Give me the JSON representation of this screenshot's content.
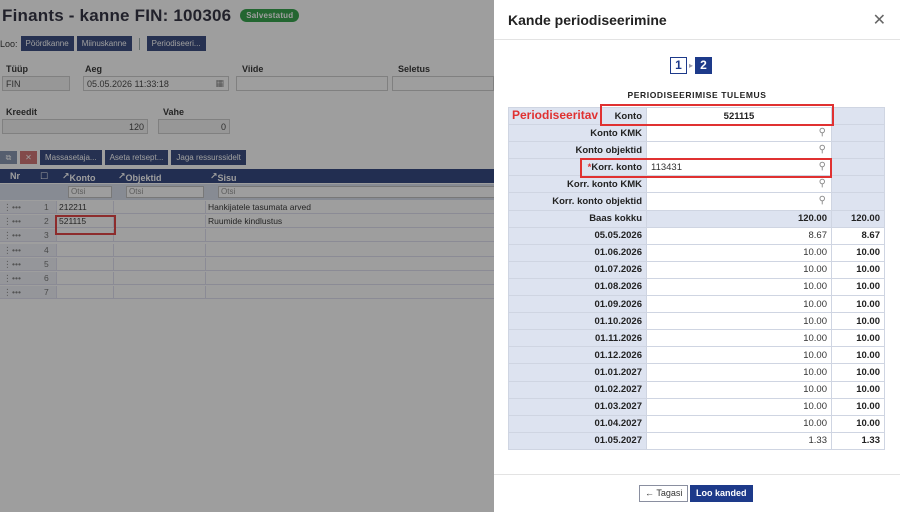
{
  "page": {
    "title": "Finants - kanne FIN: 100306",
    "status_badge": "Salvestatud",
    "loo_label": "Loo:",
    "loo_buttons": [
      "Pöördkanne",
      "Miinuskanne"
    ],
    "periodiseeri_button": "Periodiseeri...",
    "fields": {
      "tyyp_label": "Tüüp",
      "tyyp_value": "FIN",
      "aeg_label": "Aeg",
      "aeg_value": "05.05.2026 11:33:18",
      "viide_label": "Viide",
      "seletus_label": "Seletus",
      "kreedit_label": "Kreedit",
      "kreedit_value": "120",
      "vahe_label": "Vahe",
      "vahe_value": "0"
    },
    "toolbar": [
      "Massasetaja...",
      "Aseta retsept...",
      "Jaga ressurssidelt"
    ],
    "grid": {
      "columns": [
        "Nr",
        "Konto",
        "Objektid",
        "Sisu"
      ],
      "filter_placeholder": "Otsi",
      "rows": [
        {
          "nr": "1",
          "konto": "212211",
          "sisu": "Hankijatele tasumata arved"
        },
        {
          "nr": "2",
          "konto": "521115",
          "sisu": "Ruumide kindlustus"
        },
        {
          "nr": "3",
          "konto": "",
          "sisu": ""
        },
        {
          "nr": "4",
          "konto": "",
          "sisu": ""
        },
        {
          "nr": "5",
          "konto": "",
          "sisu": ""
        },
        {
          "nr": "6",
          "konto": "",
          "sisu": ""
        },
        {
          "nr": "7",
          "konto": "",
          "sisu": ""
        }
      ]
    }
  },
  "modal": {
    "title": "Kande periodiseerimine",
    "steps": [
      "1",
      "2"
    ],
    "active_step": 2,
    "result_title": "PERIODISEERIMISE TULEMUS",
    "periodiseeritav_label": "Periodiseeritav",
    "konto_label": "Konto",
    "konto_value": "521115",
    "konto_kmk_label": "Konto KMK",
    "konto_objektid_label": "Konto objektid",
    "korr_konto_required": "*",
    "korr_konto_label": "Korr. konto",
    "korr_konto_value": "113431",
    "korr_konto_kmk_label": "Korr. konto KMK",
    "korr_konto_objektid_label": "Korr. konto objektid",
    "baas_label": "Baas kokku",
    "baas_value": "120.00",
    "baas_total": "120.00",
    "periods": [
      {
        "date": "05.05.2026",
        "value": "8.67",
        "total": "8.67"
      },
      {
        "date": "01.06.2026",
        "value": "10.00",
        "total": "10.00"
      },
      {
        "date": "01.07.2026",
        "value": "10.00",
        "total": "10.00"
      },
      {
        "date": "01.08.2026",
        "value": "10.00",
        "total": "10.00"
      },
      {
        "date": "01.09.2026",
        "value": "10.00",
        "total": "10.00"
      },
      {
        "date": "01.10.2026",
        "value": "10.00",
        "total": "10.00"
      },
      {
        "date": "01.11.2026",
        "value": "10.00",
        "total": "10.00"
      },
      {
        "date": "01.12.2026",
        "value": "10.00",
        "total": "10.00"
      },
      {
        "date": "01.01.2027",
        "value": "10.00",
        "total": "10.00"
      },
      {
        "date": "01.02.2027",
        "value": "10.00",
        "total": "10.00"
      },
      {
        "date": "01.03.2027",
        "value": "10.00",
        "total": "10.00"
      },
      {
        "date": "01.04.2027",
        "value": "10.00",
        "total": "10.00"
      },
      {
        "date": "01.05.2027",
        "value": "1.33",
        "total": "1.33"
      }
    ],
    "back_button": "← Tagasi",
    "create_button": "Loo kanded"
  },
  "colors": {
    "accent": "#1d3a8a",
    "highlight": "#e03131",
    "saved_badge": "#1f9a3a"
  }
}
